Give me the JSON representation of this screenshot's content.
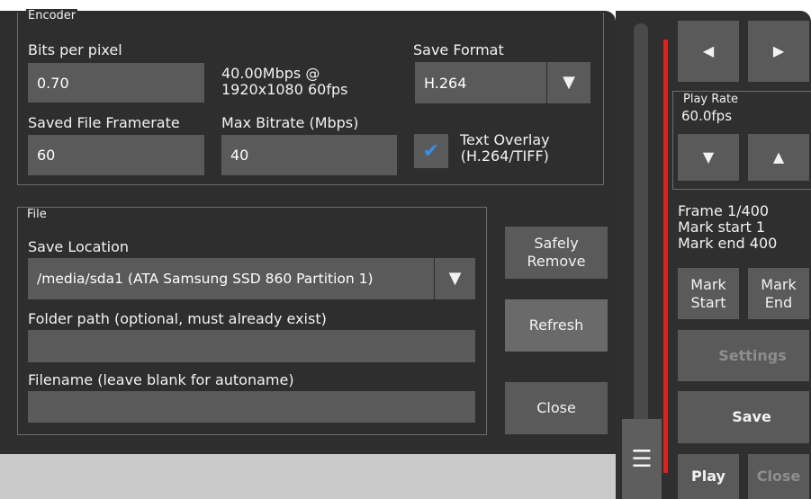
{
  "encoder": {
    "legend": "Encoder",
    "bpp_label": "Bits per pixel",
    "bpp_value": "0.70",
    "bitrate_info_line1": "40.00Mbps @",
    "bitrate_info_line2": "1920x1080 60fps",
    "save_format_label": "Save Format",
    "save_format_value": "H.264",
    "framerate_label": "Saved File Framerate",
    "framerate_value": "60",
    "max_bitrate_label": "Max Bitrate (Mbps)",
    "max_bitrate_value": "40",
    "text_overlay_line1": "Text Overlay",
    "text_overlay_line2": "(H.264/TIFF)",
    "text_overlay_checked": true
  },
  "file": {
    "legend": "File",
    "save_location_label": "Save Location",
    "save_location_value": "/media/sda1 (ATA Samsung SSD 860 Partition 1)",
    "folder_label": "Folder path (optional, must already exist)",
    "folder_value": "",
    "filename_label": "Filename (leave blank for autoname)",
    "filename_value": ""
  },
  "actions": {
    "safely_remove_line1": "Safely",
    "safely_remove_line2": "Remove",
    "refresh": "Refresh",
    "close": "Close"
  },
  "playback": {
    "play_rate_legend": "Play Rate",
    "play_rate_value": "60.0fps",
    "frame_info": "Frame 1/400",
    "mark_start_info": "Mark start 1",
    "mark_end_info": "Mark end 400",
    "mark_start_line1": "Mark",
    "mark_start_line2": "Start",
    "mark_end_line1": "Mark",
    "mark_end_line2": "End",
    "settings": "Settings",
    "save": "Save",
    "play": "Play",
    "close": "Close",
    "seek_position": 0
  },
  "colors": {
    "accent_red": "#dd2222",
    "checkbox_check": "#3a8ee6"
  },
  "icons": {
    "prev": "triangle-left",
    "next": "triangle-right",
    "down": "triangle-down",
    "up": "triangle-up",
    "menu": "hamburger"
  }
}
